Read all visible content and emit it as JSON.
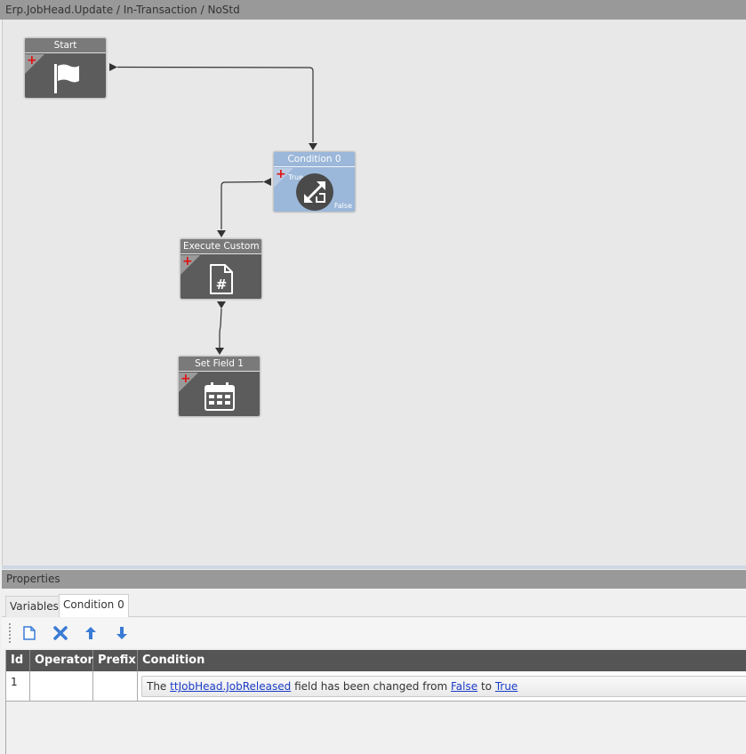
{
  "window": {
    "title": "Erp.JobHead.Update / In-Transaction / NoStd"
  },
  "workflow": {
    "nodes": {
      "start": {
        "label": "Start"
      },
      "condition": {
        "label": "Condition 0",
        "true_label": "True",
        "false_label": "False"
      },
      "custom_code": {
        "label": "Execute Custom Co"
      },
      "set_field": {
        "label": "Set Field 1"
      }
    }
  },
  "properties": {
    "title": "Properties",
    "tabs": [
      {
        "label": "Variables"
      },
      {
        "label": "Condition 0"
      }
    ],
    "toolbar": [
      "new-icon",
      "delete-icon",
      "move-up-icon",
      "move-down-icon"
    ],
    "grid": {
      "columns": [
        "Id",
        "Operator",
        "Prefix",
        "Condition"
      ],
      "rows": [
        {
          "id": "1",
          "operator": "",
          "prefix": "",
          "condition": {
            "text1": "The",
            "field": "ttJobHead.JobReleased",
            "text2": "field has been changed from",
            "from": "False",
            "text3": "to",
            "to": "True"
          }
        }
      ]
    }
  },
  "colors": {
    "node_dark": "#5c5c5c",
    "node_condition": "#9bb7d9",
    "header_gray": "#999999",
    "grid_header": "#555555",
    "link": "#1a3cc8",
    "plus_red": "#e01010"
  }
}
